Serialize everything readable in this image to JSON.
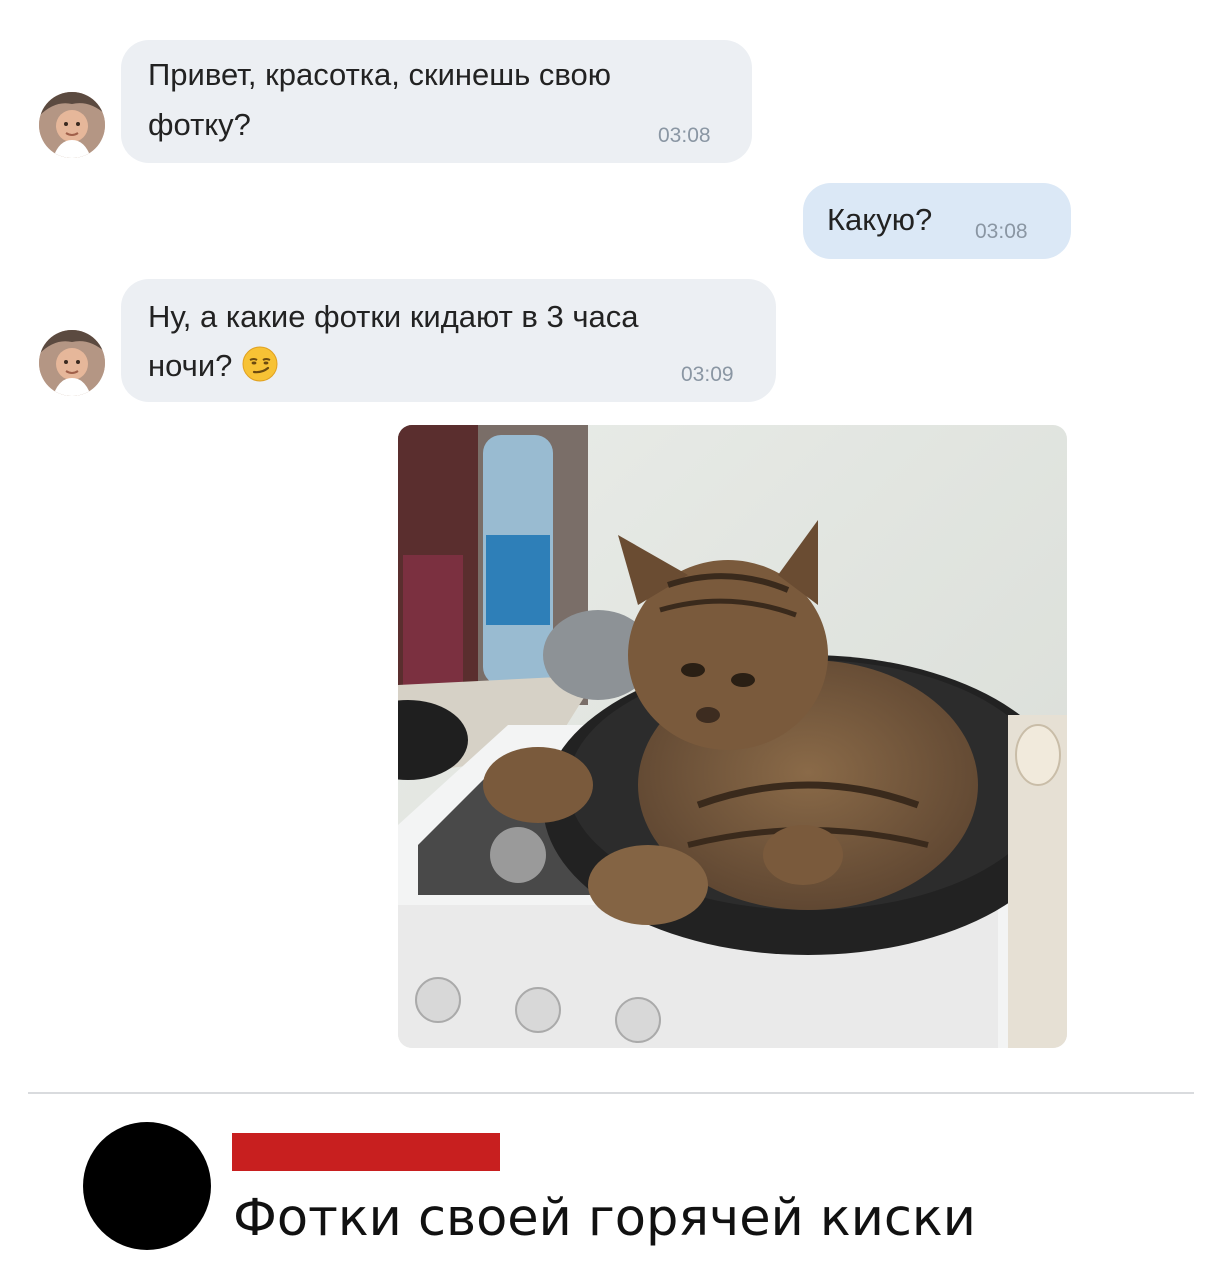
{
  "messages": [
    {
      "direction": "incoming",
      "text_line1": "Привет, красотка, скинешь свою",
      "text_line2": "фотку?",
      "time": "03:08"
    },
    {
      "direction": "outgoing",
      "text_line1": "Какую?",
      "time": "03:08"
    },
    {
      "direction": "incoming",
      "text_line1": "Ну, а какие фотки кидают в 3 часа",
      "text_line2": "ночи?",
      "emoji": "smirking-face",
      "time": "03:09"
    }
  ],
  "attachment": {
    "type": "photo",
    "subject": "cat-in-frying-pan"
  },
  "comment": {
    "text": "Фотки своей горячей киски",
    "author_name_redacted": true
  },
  "colors": {
    "incoming_bubble": "#eceff3",
    "outgoing_bubble": "#dbe8f6",
    "time_text": "#8a96a3",
    "redaction": "#c81f1f"
  }
}
